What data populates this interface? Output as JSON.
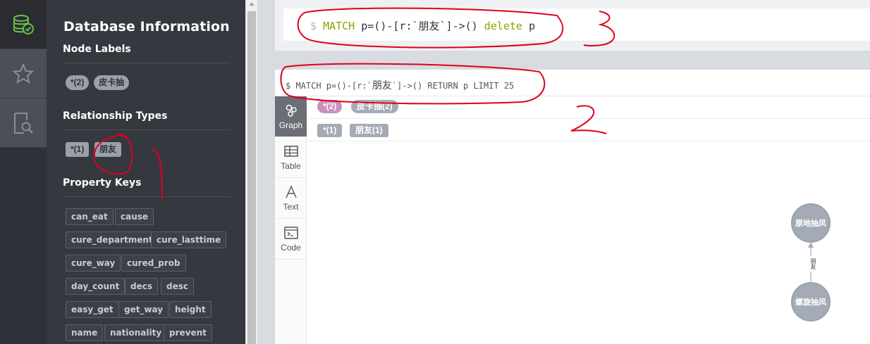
{
  "drawer": {
    "title": "Database Information",
    "node_labels": {
      "title": "Node Labels",
      "items": [
        "*(2)",
        "皮卡抽"
      ]
    },
    "relationship_types": {
      "title": "Relationship Types",
      "items": [
        "*(1)",
        "朋友"
      ]
    },
    "property_keys": {
      "title": "Property Keys",
      "items": [
        "can_eat",
        "cause",
        "cure_department",
        "cure_lasttime",
        "cure_way",
        "cured_prob",
        "day_count",
        "decs",
        "desc",
        "easy_get",
        "get_way",
        "height",
        "name",
        "nationality",
        "prevent"
      ]
    }
  },
  "editor": {
    "prompt": "$",
    "query_keyword": "MATCH",
    "query_middle": " p=()-[r:`朋友`]->() ",
    "query_keyword2": "delete",
    "query_end": " p"
  },
  "frame": {
    "command_prefix": "$ MATCH p=()-[r:`",
    "command_zh": "朋友",
    "command_suffix": "`]->() RETURN p LIMIT 25",
    "tabs": [
      "Graph",
      "Table",
      "Text",
      "Code"
    ],
    "node_legend": [
      "*(2)",
      "皮卡抽(2)"
    ],
    "rel_legend": [
      "*(1)",
      "朋友(1)"
    ],
    "nodes": [
      "原地抽风",
      "螺旋抽风"
    ],
    "rel_label": "朋友"
  },
  "colors": {
    "accent_green": "#6cc04a",
    "node_gray": "#a5abb6",
    "label_pink": "#c990c0",
    "annotation_red": "#e0001a"
  }
}
